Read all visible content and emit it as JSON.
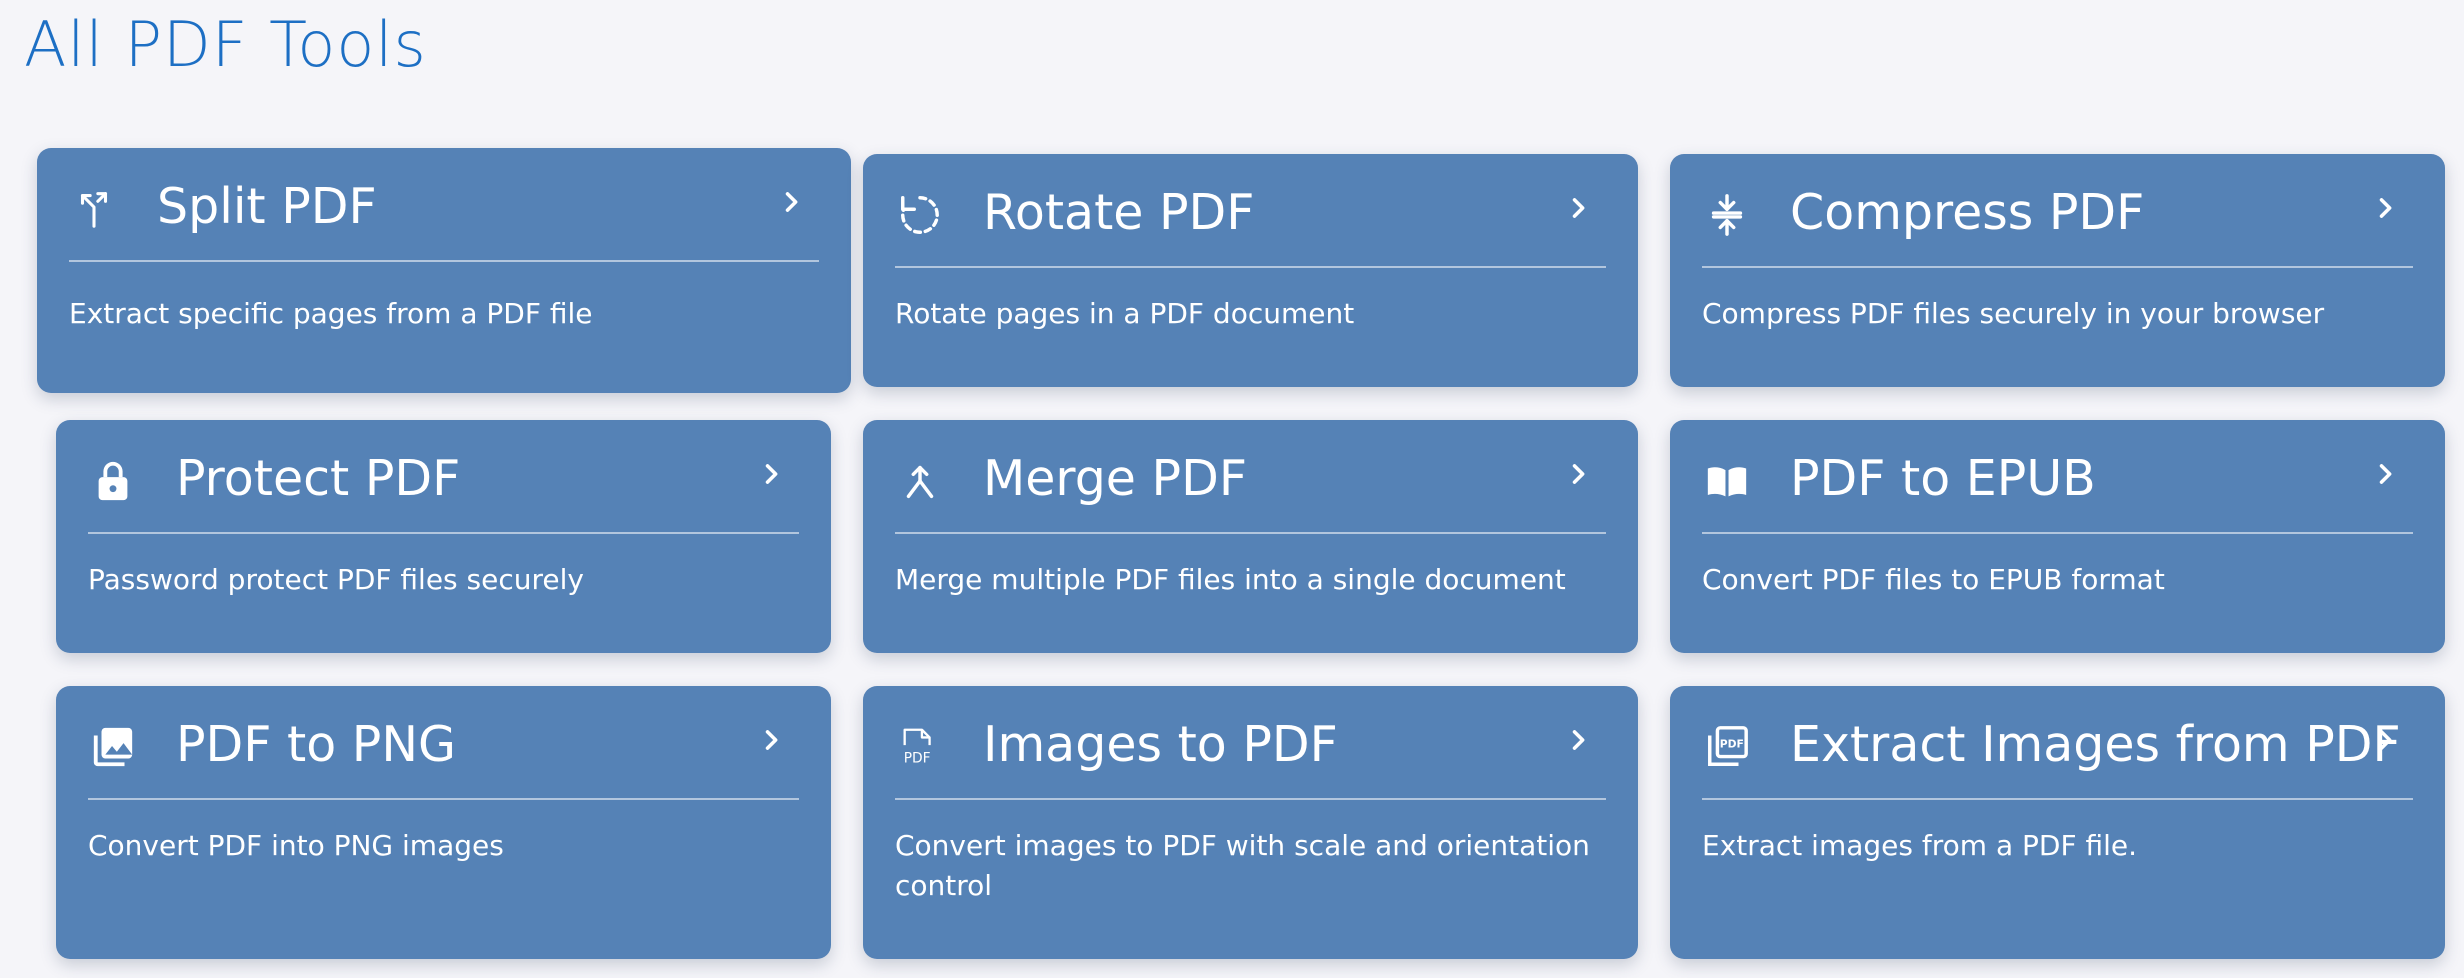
{
  "page": {
    "title": "All PDF Tools"
  },
  "colors": {
    "background": "#f5f5f9",
    "title": "#1d6fc4",
    "card": "#5582b6",
    "card_text": "#ffffff"
  },
  "tools": [
    {
      "title": "Split PDF",
      "description": "Extract specific pages from a PDF file",
      "icon": "split-icon"
    },
    {
      "title": "Rotate PDF",
      "description": "Rotate pages in a PDF document",
      "icon": "rotate-icon"
    },
    {
      "title": "Compress PDF",
      "description": "Compress PDF files securely in your browser",
      "icon": "compress-icon"
    },
    {
      "title": "Protect PDF",
      "description": "Password protect PDF files securely",
      "icon": "lock-icon"
    },
    {
      "title": "Merge PDF",
      "description": "Merge multiple PDF files into a single document",
      "icon": "merge-icon"
    },
    {
      "title": "PDF to EPUB",
      "description": "Convert PDF files to EPUB format",
      "icon": "book-icon"
    },
    {
      "title": "PDF to PNG",
      "description": "Convert PDF into PNG images",
      "icon": "images-icon"
    },
    {
      "title": "Images to PDF",
      "description": "Convert images to PDF with scale and orientation control",
      "icon": "pdf-file-icon",
      "icon_text": "PDF"
    },
    {
      "title": "Extract Images from PDF",
      "description": "Extract images from a PDF file.",
      "icon": "pdf-stack-icon",
      "icon_text": "PDF"
    }
  ]
}
